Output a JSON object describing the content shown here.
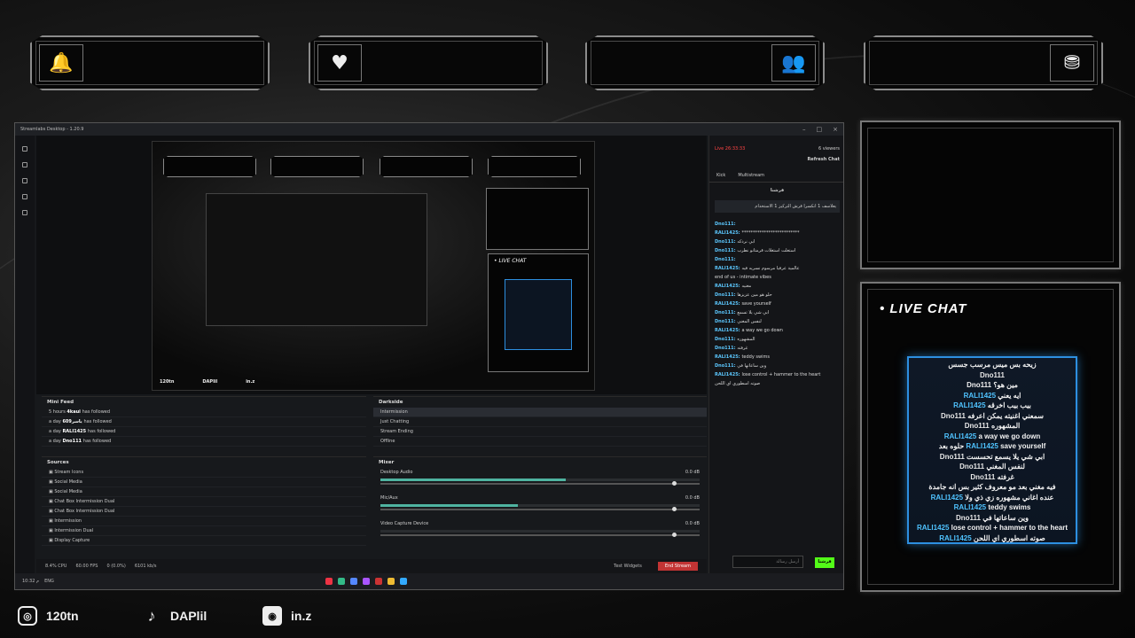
{
  "overlay": {
    "alerts": [
      {
        "icon": "bell-icon",
        "glyph": "🔔"
      },
      {
        "icon": "heart-hand-icon",
        "glyph": "♥"
      },
      {
        "icon": "users-check-icon",
        "glyph": "👥"
      },
      {
        "icon": "coins-icon",
        "glyph": "⛃"
      }
    ],
    "live_chat_title": "• LIVE CHAT",
    "socials": [
      {
        "icon": "instagram-icon",
        "glyph": "◎",
        "label": "120tn"
      },
      {
        "icon": "tiktok-icon",
        "glyph": "♪",
        "label": "DAPlil"
      },
      {
        "icon": "discord-icon",
        "glyph": "◉",
        "label": "in.z"
      }
    ],
    "chat_messages": [
      {
        "user": "",
        "text": "زيحه بس ميس مرسب جسس"
      },
      {
        "user": "Dno111",
        "text": ""
      },
      {
        "user": "",
        "text": "مين هو؟",
        "tag": "Dno111"
      },
      {
        "user": "RALI1425",
        "text": "ايه يعني"
      },
      {
        "user": "RALI1425",
        "text": "بيب بيب اخرقه"
      },
      {
        "user": "Dno111",
        "text": "سمعني اغنيته يمكن اعرفه"
      },
      {
        "user": "Dno111",
        "text": "المشهوره"
      },
      {
        "user": "RALI1425",
        "text": "a way we go down"
      },
      {
        "user": "RALI1425",
        "text": "save yourself",
        "pre": "حلوه بعد"
      },
      {
        "user": "Dno111",
        "text": "ابي شي يلا يسمع تحسست"
      },
      {
        "user": "Dno111",
        "text": "لنفس المغني"
      },
      {
        "user": "Dno111",
        "text": "غرفته"
      },
      {
        "user": "",
        "text": "فيه مغني بعد مو معروف كثير بس انه جامدة"
      },
      {
        "user": "RALI1425",
        "text": "",
        "tag": "عنده اغاني مشهوره زي ذي ولا"
      },
      {
        "user": "RALI1425",
        "text": "teddy swims"
      },
      {
        "user": "Dno111",
        "text": "وين ساعاتها في"
      },
      {
        "user": "RALI1425",
        "text": "lose control + hammer to the heart"
      },
      {
        "user": "RALI1425",
        "text": "صوته اسطوري اي اللحن",
        "pre": ""
      }
    ]
  },
  "app": {
    "title": "Streamlabs Desktop - 1.20.9",
    "mini_feed_title": "Mini Feed",
    "mini_feed": [
      {
        "time": "5 hours",
        "user": "4kaui",
        "action": "has followed"
      },
      {
        "time": "a day",
        "user": "ياسر609",
        "action": "has followed"
      },
      {
        "time": "a day",
        "user": "RALI1425",
        "action": "has followed"
      },
      {
        "time": "a day",
        "user": "Dno111",
        "action": "has followed"
      }
    ],
    "scene_collection": "Darkside",
    "scenes": [
      "Intermission",
      "Just Chatting",
      "Stream Ending",
      "Offline"
    ],
    "sources_title": "Sources",
    "sources": [
      "Stream Icons",
      "Social Media",
      "Social Media",
      "Chat Box Intermission Dual",
      "Chat Box Intermission Dual",
      "Intermission",
      "Intermission Dual",
      "Display Capture"
    ],
    "mixer_title": "Mixer",
    "mixer": [
      {
        "name": "Desktop Audio",
        "db": "0.0 dB",
        "level": 0.58
      },
      {
        "name": "Mic/Aux",
        "db": "0.0 dB",
        "level": 0.43
      },
      {
        "name": "Video Capture Device",
        "db": "0.0 dB",
        "level": 0.0
      }
    ],
    "status": {
      "cpu": "8.4% CPU",
      "fps": "60.00 FPS",
      "dropped": "0 (0.0%)",
      "bitrate": "6101 kb/s",
      "test_widgets": "Test Widgets",
      "end_stream": "End Stream"
    },
    "dock": {
      "live_time": "Live 26:33:33",
      "viewers": "6 viewers",
      "refresh": "Refresh Chat",
      "tabs": [
        "Kick",
        "Multistream"
      ],
      "channel": "قرشنا",
      "pinned": "يعلاسف 1 انكسرا قرش التركيز 1 الاستخدام",
      "input_placeholder": "أرسل رسالة",
      "send": "قرشنا",
      "chat": [
        {
          "user": "Dno111",
          "text": ""
        },
        {
          "user": "RALI1425",
          "text": "**************************"
        },
        {
          "user": "Dno111",
          "text": "ابي نردكه"
        },
        {
          "user": "Dno111",
          "text": "استغلت استغلات قرمتانو نطرب"
        },
        {
          "user": "Dno111",
          "text": ""
        },
        {
          "user": "RALI1425",
          "text": "عالمية عرفيا مرسوم نسريه فيه"
        },
        {
          "user": "",
          "text": "end of us - intimate vibes"
        },
        {
          "user": "RALI1425",
          "text": "مغنيه"
        },
        {
          "user": "Dno111",
          "text": "حلو هو مين عزيزها"
        },
        {
          "user": "RALI1425",
          "text": "save yourself"
        },
        {
          "user": "Dno111",
          "text": "ابي شي يلا تسمع"
        },
        {
          "user": "Dno111",
          "text": "لنفس المغني"
        },
        {
          "user": "RALI1425",
          "text": "a way we go down"
        },
        {
          "user": "Dno111",
          "text": "المشهوره"
        },
        {
          "user": "Dno111",
          "text": "غرفته"
        },
        {
          "user": "RALI1425",
          "text": "teddy swims"
        },
        {
          "user": "Dno111",
          "text": "وين ساعاتها في"
        },
        {
          "user": "RALI1425",
          "text": "lose control + hammer to the heart"
        },
        {
          "user": "",
          "text": "صوته اسطوري اي اللحن"
        }
      ]
    },
    "taskbar": {
      "lang": "ENG",
      "clock": "10:32 م"
    }
  }
}
